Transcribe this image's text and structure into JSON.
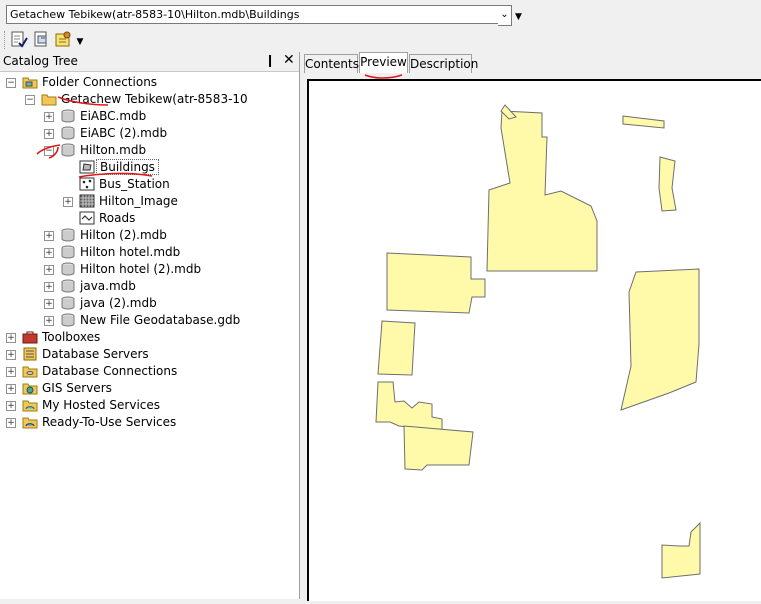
{
  "location": {
    "path": "Getachew Tebikew(atr-8583-10\\Hilton.mdb\\Buildings"
  },
  "toolbar": {
    "icons": [
      "connect-folder-icon",
      "new-item-icon",
      "options-icon"
    ]
  },
  "catalog": {
    "title": "Catalog Tree",
    "pin": "❙",
    "close": "✕",
    "items": [
      {
        "label": "Folder Connections",
        "icon": "folder-connections-icon",
        "expanded": true
      },
      {
        "label": "Getachew Tebikew(atr-8583-10",
        "icon": "folder-icon",
        "expanded": true
      },
      {
        "label": "EiABC.mdb",
        "icon": "database-icon"
      },
      {
        "label": "EiABC (2).mdb",
        "icon": "database-icon"
      },
      {
        "label": "Hilton.mdb",
        "icon": "database-icon",
        "expanded": true
      },
      {
        "label": "Buildings",
        "icon": "polygon-feature-icon",
        "selected": true
      },
      {
        "label": "Bus_Station",
        "icon": "point-feature-icon"
      },
      {
        "label": "Hilton_Image",
        "icon": "raster-icon"
      },
      {
        "label": "Roads",
        "icon": "line-feature-icon"
      },
      {
        "label": "Hilton (2).mdb",
        "icon": "database-icon"
      },
      {
        "label": "Hilton hotel.mdb",
        "icon": "database-icon"
      },
      {
        "label": "Hilton hotel (2).mdb",
        "icon": "database-icon"
      },
      {
        "label": "java.mdb",
        "icon": "database-icon"
      },
      {
        "label": "java (2).mdb",
        "icon": "database-icon"
      },
      {
        "label": "New File Geodatabase.gdb",
        "icon": "database-icon"
      },
      {
        "label": "Toolboxes",
        "icon": "toolbox-icon"
      },
      {
        "label": "Database Servers",
        "icon": "database-server-icon"
      },
      {
        "label": "Database Connections",
        "icon": "database-connections-icon"
      },
      {
        "label": "GIS Servers",
        "icon": "gis-server-icon"
      },
      {
        "label": "My Hosted Services",
        "icon": "hosted-services-icon"
      },
      {
        "label": "Ready-To-Use Services",
        "icon": "ready-services-icon"
      }
    ]
  },
  "view": {
    "tabs": [
      {
        "label": "Contents",
        "active": false
      },
      {
        "label": "Preview",
        "active": true
      },
      {
        "label": "Description",
        "active": false
      }
    ]
  },
  "colors": {
    "polygon_fill": "#fffaaa",
    "polygon_stroke": "#6e6e6e",
    "annotation": "#e01818"
  }
}
